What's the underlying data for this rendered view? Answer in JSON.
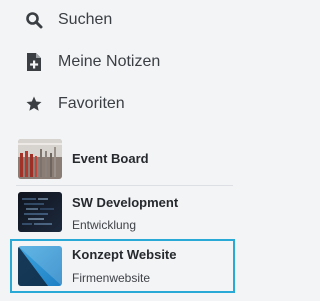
{
  "nav": {
    "items": [
      {
        "label": "Suchen",
        "icon": "search-icon"
      },
      {
        "label": "Meine Notizen",
        "icon": "note-add-icon"
      },
      {
        "label": "Favoriten",
        "icon": "star-icon"
      }
    ]
  },
  "boards": [
    {
      "title": "Event Board",
      "subtitle": "",
      "thumb": "conference-photo"
    },
    {
      "title": "SW Development",
      "subtitle": "Entwicklung",
      "thumb": "code-screen-photo"
    },
    {
      "title": "Konzept Website",
      "subtitle": "Firmenwebsite",
      "thumb": "blue-gradient",
      "selected": true
    }
  ],
  "colors": {
    "selection_border": "#28a9d6",
    "background": "#f3f4f6"
  }
}
